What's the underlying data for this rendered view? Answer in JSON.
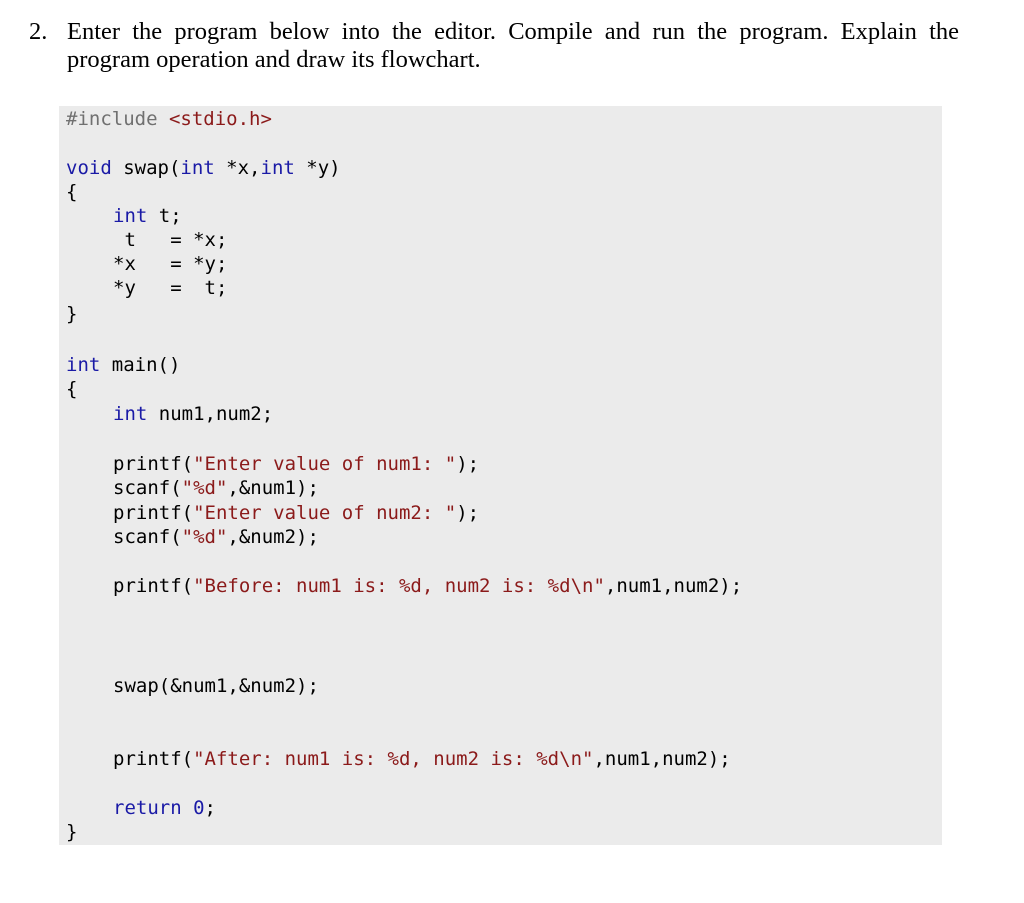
{
  "question": {
    "number": "2.",
    "text": "Enter the program below into the editor. Compile and run the program. Explain the program operation and draw its flowchart."
  },
  "code": {
    "include_directive": "#include",
    "include_header": "<stdio.h>",
    "swap_sig_kw_void": "void",
    "swap_sig_name": " swap(",
    "swap_sig_kw_int1": "int",
    "swap_sig_param1": " *x,",
    "swap_sig_kw_int2": "int",
    "swap_sig_param2": " *y)",
    "open_brace_1": "{",
    "swap_decl_kw": "int",
    "swap_decl_rest": " t;",
    "swap_line1": " t   = *x;",
    "swap_line2": "*x   = *y;",
    "swap_line3": "*y   =  t;",
    "close_brace_1": "}",
    "main_kw": "int",
    "main_rest": " main()",
    "open_brace_2": "{",
    "main_decl_kw": "int",
    "main_decl_rest": " num1,num2;",
    "printf1_pre": "printf(",
    "printf1_str": "\"Enter value of num1: \"",
    "printf1_post": ");",
    "scanf1_pre": "scanf(",
    "scanf1_str": "\"%d\"",
    "scanf1_post": ",&num1);",
    "printf2_pre": "printf(",
    "printf2_str": "\"Enter value of num2: \"",
    "printf2_post": ");",
    "scanf2_pre": "scanf(",
    "scanf2_str": "\"%d\"",
    "scanf2_post": ",&num2);",
    "printf_before_pre": "printf(",
    "printf_before_str": "\"Before: num1 is: %d, num2 is: %d\\n\"",
    "printf_before_post": ",num1,num2);",
    "swap_call": "swap(&num1,&num2);",
    "printf_after_pre": "printf(",
    "printf_after_str": "\"After: num1 is: %d, num2 is: %d\\n\"",
    "printf_after_post": ",num1,num2);",
    "return_kw": "return",
    "return_val": " 0",
    "return_semi": ";",
    "close_brace_2": "}"
  }
}
